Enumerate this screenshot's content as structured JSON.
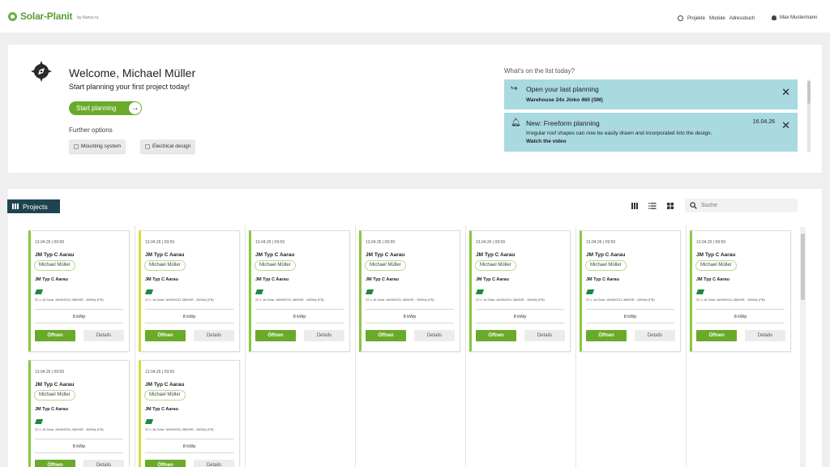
{
  "header": {
    "logo_text": "Solar-Planit",
    "logo_sub": "by Ikarus ru",
    "nav_items": [
      "Projekte",
      "Module",
      "Adressbuch"
    ],
    "user_name": "Max Mustermann"
  },
  "welcome": {
    "title": "Welcome, Michael Müller",
    "subtitle": "Start planning your first project today!",
    "start_button": "Start planning",
    "further_label": "Further options",
    "option_mounting": "Mounting system",
    "option_electrical": "Electrical design"
  },
  "todo": {
    "title": "What's on the list today?",
    "notices": [
      {
        "title": "Open your last planning",
        "bold": "Warehouse  24x Jinko 460 (SM)"
      },
      {
        "title": "New: Freeform planning",
        "date": "16.04.26",
        "desc": "Irregular roof shapes can now be easily drawn and incorporated into the design.",
        "bold": "Watch the video"
      }
    ]
  },
  "projects": {
    "badge_label": "Projects",
    "search_placeholder": "Suche",
    "cards": [
      {
        "date": "13.04.26 | 09:59",
        "name": "JM Typ C Aarau",
        "owner": "Michael Müller",
        "type": "JM Typ C Aarau",
        "spec": "22 x JA Solar JAM54S31-380/MR - 380Wp (FB)",
        "power": "8 kWp",
        "open": "Öffnen",
        "details": "Details",
        "accent": "green"
      },
      {
        "date": "13.04.26 | 09:59",
        "name": "JM Typ C Aarau",
        "owner": "Michael Müller",
        "type": "JM Typ C Aarau",
        "spec": "22 x JA Solar JAM54S31-380/MR - 380Wp (FB)",
        "power": "8 kWp",
        "open": "Öffnen",
        "details": "Details",
        "accent": "yellow"
      },
      {
        "date": "13.04.26 | 09:59",
        "name": "JM Typ C Aarau",
        "owner": "Michael Müller",
        "type": "JM Typ C Aarau",
        "spec": "22 x JA Solar JAM54S31-380/MR - 380Wp (FB)",
        "power": "8 kWp",
        "open": "Öffnen",
        "details": "Details",
        "accent": "green"
      },
      {
        "date": "13.04.26 | 09:59",
        "name": "JM Typ C Aarau",
        "owner": "Michael Müller",
        "type": "JM Typ C Aarau",
        "spec": "22 x JA Solar JAM54S31-380/MR - 380Wp (FB)",
        "power": "8 kWp",
        "open": "Öffnen",
        "details": "Details",
        "accent": "green"
      },
      {
        "date": "13.04.26 | 09:59",
        "name": "JM Typ C Aarau",
        "owner": "Michael Müller",
        "type": "JM Typ C Aarau",
        "spec": "22 x JA Solar JAM54S31-380/MR - 380Wp (FB)",
        "power": "8 kWp",
        "open": "Öffnen",
        "details": "Details",
        "accent": "green"
      },
      {
        "date": "13.04.26 | 09:59",
        "name": "JM Typ C Aarau",
        "owner": "Michael Müller",
        "type": "JM Typ C Aarau",
        "spec": "22 x JA Solar JAM54S31-380/MR - 380Wp (FB)",
        "power": "8 kWp",
        "open": "Öffnen",
        "details": "Details",
        "accent": "green"
      },
      {
        "date": "13.04.26 | 09:59",
        "name": "JM Typ C Aarau",
        "owner": "Michael Müller",
        "type": "JM Typ C Aarau",
        "spec": "22 x JA Solar JAM54S31-380/MR - 380Wp (FB)",
        "power": "8 kWp",
        "open": "Öffnen",
        "details": "Details",
        "accent": "green"
      },
      {
        "date": "13.04.26 | 09:59",
        "name": "JM Typ C Aarau",
        "owner": "Michael Müller",
        "type": "JM Typ C Aarau",
        "spec": "22 x JA Solar JAM54S31-380/MR - 380Wp (FB)",
        "power": "8 kWp",
        "open": "Öffnen",
        "details": "Details",
        "accent": "green"
      },
      {
        "date": "13.04.26 | 09:59",
        "name": "JM Typ C Aarau",
        "owner": "Michael Müller",
        "type": "JM Typ C Aarau",
        "spec": "22 x JA Solar JAM54S31-380/MR - 380Wp (FB)",
        "power": "8 kWp",
        "open": "Öffnen",
        "details": "Details",
        "accent": "yellow"
      }
    ]
  },
  "colors": {
    "brand_green": "#6aaa2a",
    "notice_bg": "#a9d9e1",
    "badge_bg": "#1f4450",
    "accent_green": "#8cc63f",
    "accent_yellow": "#d8dd3a"
  }
}
